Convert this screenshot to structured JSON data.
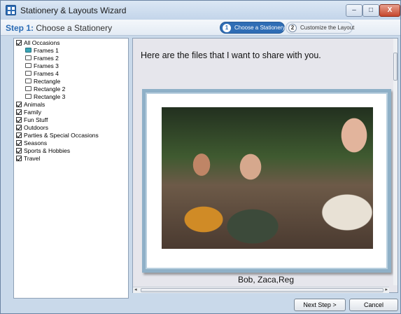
{
  "window": {
    "title": "Stationery & Layouts Wizard",
    "min_label": "–",
    "max_label": "□",
    "close_label": "X"
  },
  "stepbar": {
    "step_prefix": "Step 1:",
    "step_name": " Choose a Stationery",
    "steps": [
      {
        "num": "1",
        "label": "Choose a Stationery",
        "active": true
      },
      {
        "num": "2",
        "label": "Customize the Layout",
        "active": false
      }
    ]
  },
  "tree": {
    "items": [
      {
        "label": "All Occasions",
        "kind": "category",
        "checked": true
      },
      {
        "label": "Frames 1",
        "kind": "item",
        "selected": true
      },
      {
        "label": "Frames 2",
        "kind": "item"
      },
      {
        "label": "Frames 3",
        "kind": "item"
      },
      {
        "label": "Frames 4",
        "kind": "item"
      },
      {
        "label": "Rectangle",
        "kind": "item"
      },
      {
        "label": "Rectangle 2",
        "kind": "item"
      },
      {
        "label": "Rectangle 3",
        "kind": "item"
      },
      {
        "label": "Animals",
        "kind": "category",
        "checked": true
      },
      {
        "label": "Family",
        "kind": "category",
        "checked": true
      },
      {
        "label": "Fun Stuff",
        "kind": "category",
        "checked": true
      },
      {
        "label": "Outdoors",
        "kind": "category",
        "checked": true
      },
      {
        "label": "Parties & Special Occasions",
        "kind": "category",
        "checked": true
      },
      {
        "label": "Seasons",
        "kind": "category",
        "checked": true
      },
      {
        "label": "Sports & Hobbies",
        "kind": "category",
        "checked": true
      },
      {
        "label": "Travel",
        "kind": "category",
        "checked": true
      }
    ]
  },
  "preview": {
    "message": "Here are the files that I want to share with you.",
    "caption": "Bob, Zaca,Reg",
    "hscroll_mid": "III"
  },
  "footer": {
    "next_label": "Next Step >",
    "cancel_label": "Cancel"
  }
}
